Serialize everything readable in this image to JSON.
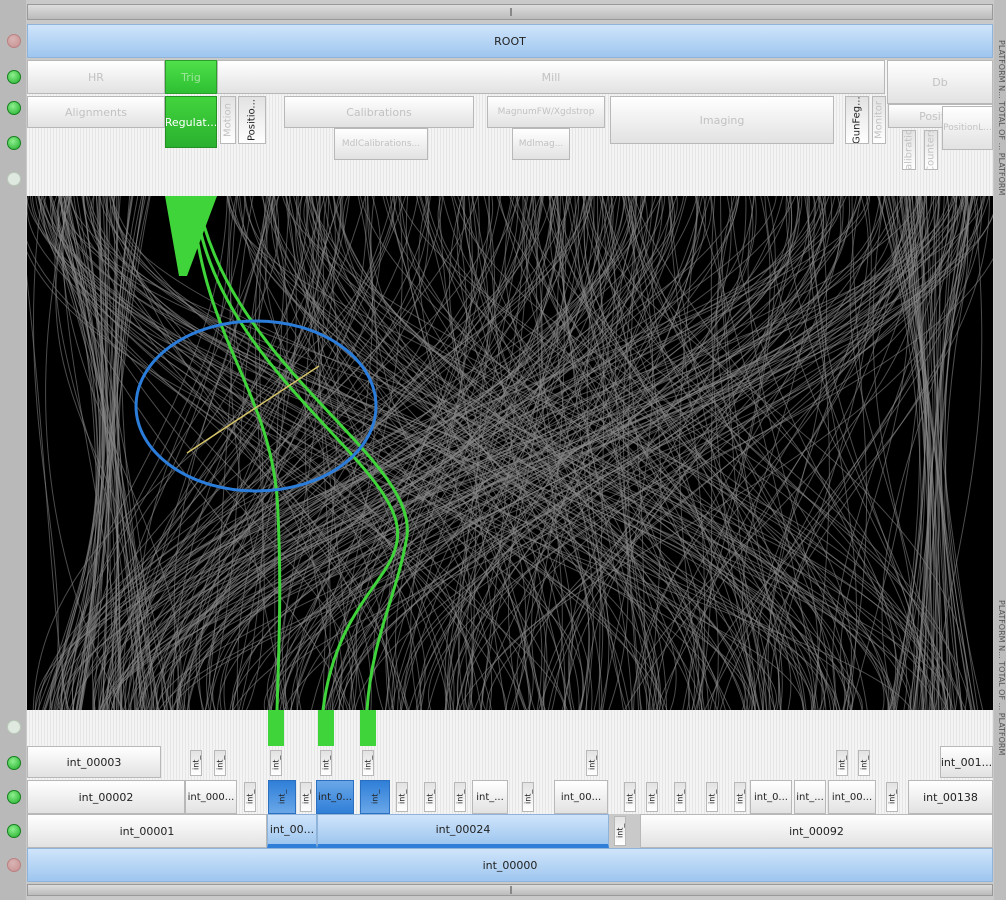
{
  "colors": {
    "highlight": "#3fd43a",
    "selection_ring": "#2b7ddb",
    "selection_line": "#d6c46a",
    "curves": "#8a8a8a",
    "canvas_bg": "#000000"
  },
  "icons": [
    "status-dot-icon",
    "drag-grip-icon"
  ],
  "top_tree": {
    "root": "ROOT",
    "level1": [
      {
        "label": "HR"
      },
      {
        "label": "Trig"
      },
      {
        "label": "Mill"
      },
      {
        "label": "Db"
      }
    ],
    "level2": [
      {
        "label": "Alignments"
      },
      {
        "label": "Regulat..."
      },
      {
        "label": "Motion"
      },
      {
        "label": "Positio..."
      },
      {
        "label": "Calibrations"
      },
      {
        "label": "MagnumFW/Xgdstrop"
      },
      {
        "label": "Imaging"
      },
      {
        "label": "GunFeg..."
      },
      {
        "label": "Monitor"
      },
      {
        "label": "Position"
      }
    ],
    "level3": [
      {
        "label": "MdlCalibrations..."
      },
      {
        "label": "Mdlmag..."
      },
      {
        "label": "Calibration"
      },
      {
        "label": "Counters"
      },
      {
        "label": "PositionL..."
      }
    ]
  },
  "bottom_tree": {
    "row3": [
      "int_00003",
      "int_",
      "int_",
      "int_",
      "int_",
      "int_",
      "int_",
      "int_",
      "int_",
      "int_001..."
    ],
    "row2": [
      "int_00002",
      "int_000...",
      "int_",
      "int_",
      "int_",
      "int_0...",
      "int_",
      "int_",
      "int_",
      "int_",
      "int_...",
      "int_",
      "int_00...",
      "int_",
      "int_",
      "int_",
      "int_",
      "int_",
      "int_0...",
      "int_...",
      "int_00...",
      "int_",
      "int_00138"
    ],
    "row1": [
      "int_00001",
      "int_00...",
      "int_00024",
      "int_",
      "int_00092"
    ],
    "root": "int_00000"
  },
  "right_margin_text": "PLATFORM N... TOTAL OF ... PLATFORM"
}
